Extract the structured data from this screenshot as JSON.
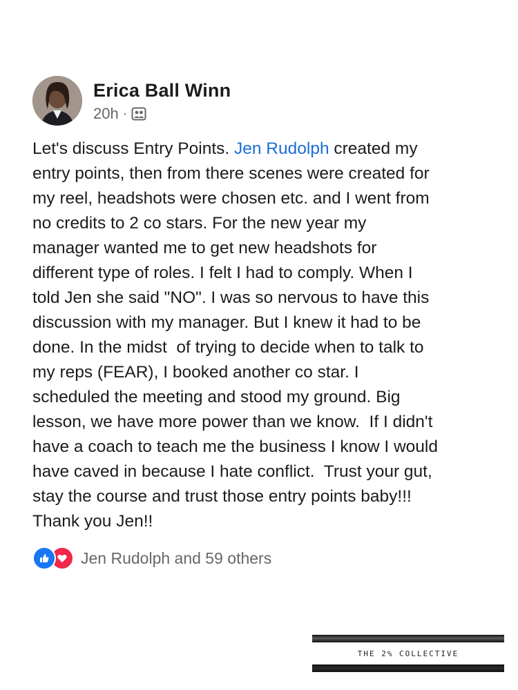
{
  "post": {
    "author": "Erica Ball Winn",
    "time": "20h",
    "separator": "·",
    "privacy_icon": "group-privacy-icon",
    "text_lines": [
      {
        "before": "Let's discuss Entry Points. ",
        "mention": "Jen Rudolph",
        "after": " created my"
      },
      {
        "text": "entry points, then from there scenes were created for"
      },
      {
        "text": "my reel, headshots were chosen etc. and I went from"
      },
      {
        "text": "no credits to 2 co stars. For the new year my"
      },
      {
        "text": "manager wanted me to get new headshots for"
      },
      {
        "text": "different type of roles. I felt I had to comply. When I"
      },
      {
        "text": "told Jen she said \"NO\". I was so nervous to have this"
      },
      {
        "text": "discussion with my manager. But I knew it had to be"
      },
      {
        "text": "done. In the midst  of trying to decide when to talk to"
      },
      {
        "text": "my reps (FEAR), I booked another co star. I"
      },
      {
        "text": "scheduled the meeting and stood my ground. Big"
      },
      {
        "text": "lesson, we have more power than we know.  If I didn't"
      },
      {
        "text": "have a coach to teach me the business I know I would"
      },
      {
        "text": "have caved in because I hate conflict.  Trust your gut,"
      },
      {
        "text": "stay the course and trust those entry points baby!!!"
      },
      {
        "text": "Thank you Jen!!"
      }
    ],
    "reactions": {
      "icons": [
        "like-icon",
        "love-icon"
      ],
      "summary": "Jen Rudolph and 59 others"
    }
  },
  "watermark": {
    "text": "THE 2% COLLECTIVE"
  },
  "colors": {
    "mention": "#1a6ed8",
    "like": "#1877f2",
    "love": "#f0284a",
    "secondary_text": "#65676b"
  }
}
